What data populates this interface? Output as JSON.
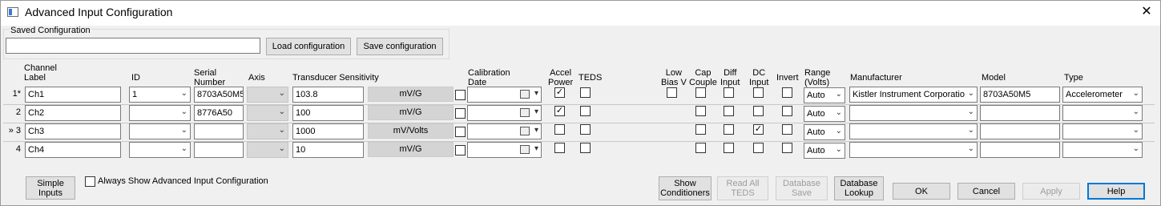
{
  "window": {
    "title": "Advanced Input Configuration",
    "close_glyph": "✕"
  },
  "saved": {
    "group_label": "Saved Configuration",
    "value": "",
    "load_label": "Load configuration",
    "save_label": "Save configuration"
  },
  "headers": {
    "channel_label": "Channel\nLabel",
    "id": "ID",
    "serial": "Serial\nNumber",
    "axis": "Axis",
    "transducer": "Transducer Sensitivity",
    "cal_date": "Calibration\nDate",
    "accel_power": "Accel\nPower",
    "teds": "TEDS",
    "low_bias": "Low\nBias V",
    "cap_couple": "Cap\nCouple",
    "diff_input": "Diff\nInput",
    "dc_input": "DC\nInput",
    "invert": "Invert",
    "range": "Range\n(Volts)",
    "manufacturer": "Manufacturer",
    "model": "Model",
    "type": "Type"
  },
  "rows": [
    {
      "marker": "1*",
      "label": "Ch1",
      "id": "1",
      "serial": "8703A50M5",
      "axis": "",
      "sensitivity": "103.8",
      "unit": "mV/G",
      "accel_power": true,
      "teds": false,
      "low_bias": false,
      "cap_couple": false,
      "diff_input": false,
      "dc_input": false,
      "invert": false,
      "range": "Auto",
      "manufacturer": "Kistler Instrument Corporatio",
      "model": "8703A50M5",
      "type": "Accelerometer"
    },
    {
      "marker": "2",
      "label": "Ch2",
      "id": "",
      "serial": "8776A50",
      "axis": "",
      "sensitivity": "100",
      "unit": "mV/G",
      "accel_power": true,
      "teds": false,
      "low_bias": null,
      "cap_couple": false,
      "diff_input": false,
      "dc_input": false,
      "invert": false,
      "range": "Auto",
      "manufacturer": "",
      "model": "",
      "type": ""
    },
    {
      "marker": "» 3",
      "label": "Ch3",
      "id": "",
      "serial": "",
      "axis": "",
      "sensitivity": "1000",
      "unit": "mV/Volts",
      "accel_power": false,
      "teds": false,
      "low_bias": null,
      "cap_couple": false,
      "diff_input": false,
      "dc_input": true,
      "invert": false,
      "range": "Auto",
      "manufacturer": "",
      "model": "",
      "type": ""
    },
    {
      "marker": "4",
      "label": "Ch4",
      "id": "",
      "serial": "",
      "axis": "",
      "sensitivity": "10",
      "unit": "mV/G",
      "accel_power": false,
      "teds": false,
      "low_bias": null,
      "cap_couple": false,
      "diff_input": false,
      "dc_input": false,
      "invert": false,
      "range": "Auto",
      "manufacturer": "",
      "model": "",
      "type": ""
    }
  ],
  "bottom": {
    "simple_inputs": "Simple\nInputs",
    "always_show_label": "Always Show Advanced Input Configuration",
    "always_show_checked": false,
    "show_conditioners": "Show\nConditioners",
    "read_all_teds": "Read All\nTEDS",
    "database_save": "Database\nSave",
    "database_lookup": "Database\nLookup",
    "ok": "OK",
    "cancel": "Cancel",
    "apply": "Apply",
    "help": "Help"
  }
}
